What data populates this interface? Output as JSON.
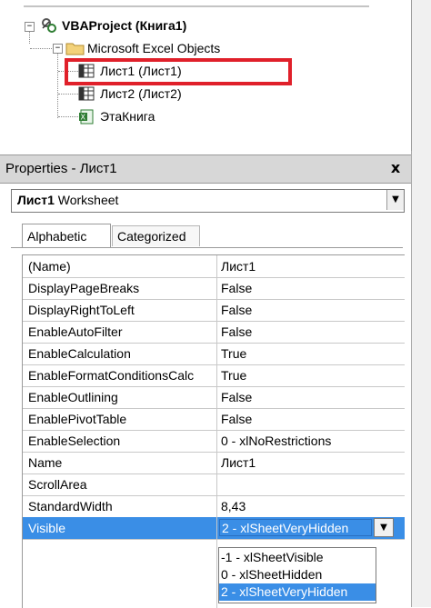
{
  "tree": {
    "project_label": "VBAProject (Книга1)",
    "folder_label": "Microsoft Excel Objects",
    "items": [
      {
        "label": "Лист1 (Лист1)"
      },
      {
        "label": "Лист2 (Лист2)"
      },
      {
        "label": "ЭтаКнига"
      }
    ]
  },
  "properties": {
    "title": "Properties - Лист1",
    "close_glyph": "x",
    "object_name": "Лист1",
    "object_type": "Worksheet",
    "tabs": [
      {
        "label": "Alphabetic"
      },
      {
        "label": "Categorized"
      }
    ],
    "rows": [
      {
        "name": "(Name)",
        "value": "Лист1"
      },
      {
        "name": "DisplayPageBreaks",
        "value": "False"
      },
      {
        "name": "DisplayRightToLeft",
        "value": "False"
      },
      {
        "name": "EnableAutoFilter",
        "value": "False"
      },
      {
        "name": "EnableCalculation",
        "value": "True"
      },
      {
        "name": "EnableFormatConditionsCalc",
        "value": "True"
      },
      {
        "name": "EnableOutlining",
        "value": "False"
      },
      {
        "name": "EnablePivotTable",
        "value": "False"
      },
      {
        "name": "EnableSelection",
        "value": "0 - xlNoRestrictions"
      },
      {
        "name": "Name",
        "value": "Лист1"
      },
      {
        "name": "ScrollArea",
        "value": ""
      },
      {
        "name": "StandardWidth",
        "value": "8,43"
      },
      {
        "name": "Visible",
        "value": "2 - xlSheetVeryHidden"
      }
    ],
    "visible_options": [
      "-1 - xlSheetVisible",
      "0 - xlSheetHidden",
      "2 - xlSheetVeryHidden"
    ],
    "selected_option_index": 2
  },
  "colors": {
    "selection": "#3a8ee6",
    "highlight_box": "#e0202a"
  }
}
